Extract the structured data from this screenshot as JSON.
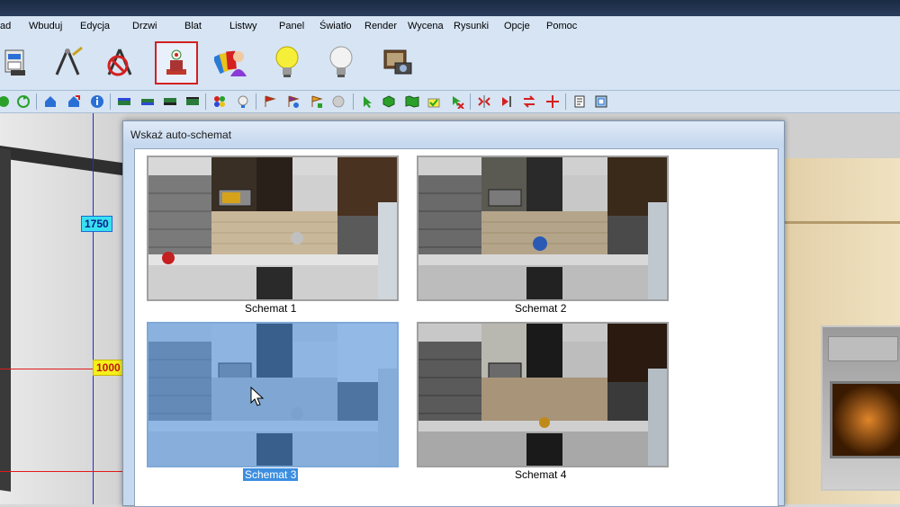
{
  "menu": {
    "items": [
      "ad",
      "Wbuduj",
      "Edycja",
      "Drzwi",
      "Blat",
      "Listwy",
      "Panel",
      "Światło",
      "Render",
      "Wycena",
      "Rysunki",
      "Opcje",
      "Pomoc"
    ]
  },
  "big_toolbar": {
    "buttons": [
      {
        "icon": "cabinet-floppy-icon"
      },
      {
        "icon": "compass-drawing-icon"
      },
      {
        "icon": "compass-forbidden-icon"
      },
      {
        "icon": "plant-auto-scheme-icon",
        "selected": true
      },
      {
        "icon": "color-palette-person-icon"
      },
      {
        "icon": "lightbulb-on-icon"
      },
      {
        "icon": "lightbulb-off-icon"
      },
      {
        "icon": "photo-camera-icon"
      }
    ]
  },
  "viewport": {
    "dimension_vertical": "1750",
    "dimension_horizontal": "1000"
  },
  "dialog": {
    "title": "Wskaż auto-schemat",
    "schemes": [
      {
        "label": "Schemat 1"
      },
      {
        "label": "Schemat 2"
      },
      {
        "label": "Schemat 3",
        "selected": true
      },
      {
        "label": "Schemat 4"
      }
    ]
  },
  "colors": {
    "menu_bg": "#d6e4f3",
    "selection_blue": "#3b8ee0",
    "selected_button_border": "#d42020"
  }
}
